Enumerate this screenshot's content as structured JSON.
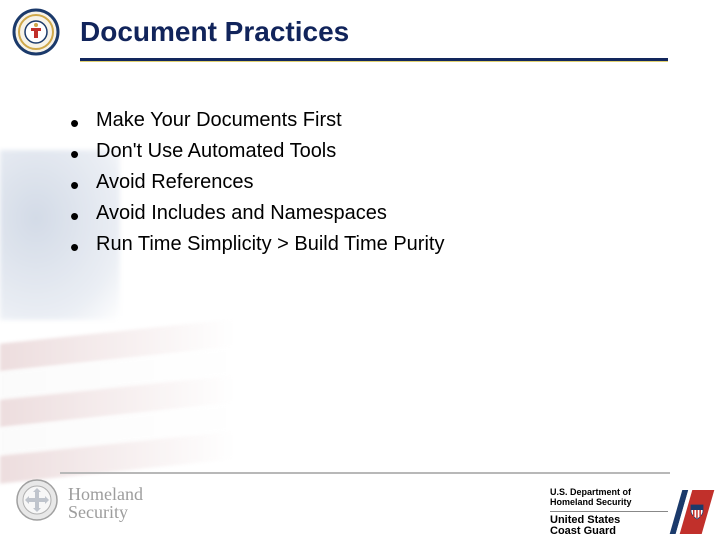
{
  "title": "Document Practices",
  "bullets": [
    "Make Your Documents First",
    "Don't Use Automated Tools",
    "Avoid References",
    "Avoid Includes and Namespaces",
    "Run Time Simplicity > Build Time Purity"
  ],
  "footer": {
    "homeland_l1": "Homeland",
    "homeland_l2": "Security",
    "dept_l1": "U.S. Department of",
    "dept_l2": "Homeland Security",
    "cg_l1": "United States",
    "cg_l2": "Coast Guard"
  },
  "icons": {
    "top_seal": "agency-seal-icon",
    "hs_seal": "dhs-seal-icon",
    "uscg_stripe": "uscg-racing-stripe-icon"
  }
}
